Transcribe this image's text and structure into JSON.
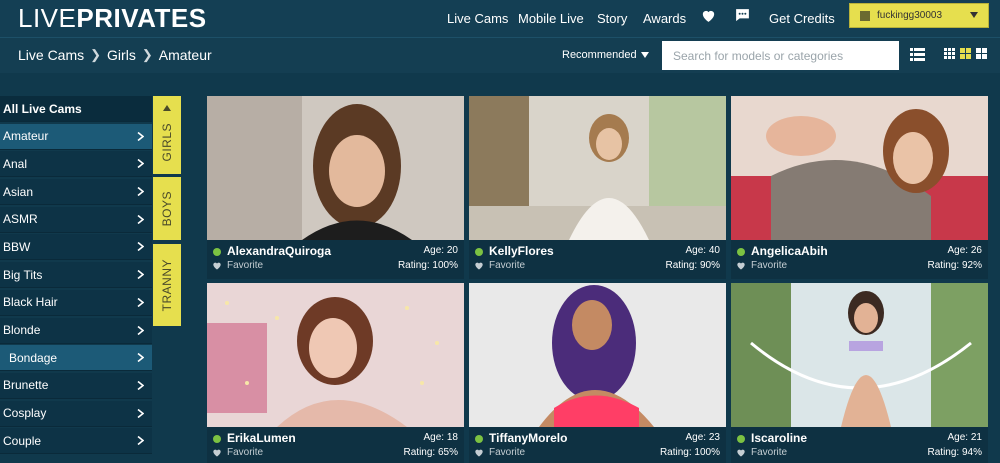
{
  "logo": {
    "part1": "LIVE",
    "part2": "PRIVATES"
  },
  "nav": {
    "live_cams": "Live Cams",
    "mobile_live": "Mobile Live",
    "story": "Story",
    "awards": "Awards",
    "get_credits": "Get Credits",
    "username": "fuckingg30003"
  },
  "breadcrumb": [
    "Live Cams",
    "Girls",
    "Amateur"
  ],
  "sort": {
    "label": "Recommended"
  },
  "search": {
    "placeholder": "Search for models or categories"
  },
  "sidebar": {
    "items": [
      {
        "label": "All Live Cams"
      },
      {
        "label": "Amateur"
      },
      {
        "label": "Anal"
      },
      {
        "label": "Asian"
      },
      {
        "label": "ASMR"
      },
      {
        "label": "BBW"
      },
      {
        "label": "Big Tits"
      },
      {
        "label": "Black Hair"
      },
      {
        "label": "Blonde"
      },
      {
        "label": "Bondage"
      },
      {
        "label": "Brunette"
      },
      {
        "label": "Cosplay"
      },
      {
        "label": "Couple"
      }
    ]
  },
  "tabs": {
    "girls": "GIRLS",
    "boys": "BOYS",
    "tranny": "TRANNY"
  },
  "models": [
    {
      "name": "AlexandraQuiroga",
      "age": "Age: 20",
      "favorite": "Favorite",
      "rating": "Rating: 100%"
    },
    {
      "name": "KellyFlores",
      "age": "Age: 40",
      "favorite": "Favorite",
      "rating": "Rating: 90%"
    },
    {
      "name": "AngelicaAbih",
      "age": "Age: 26",
      "favorite": "Favorite",
      "rating": "Rating: 92%"
    },
    {
      "name": "ErikaLumen",
      "age": "Age: 18",
      "favorite": "Favorite",
      "rating": "Rating: 65%"
    },
    {
      "name": "TiffanyMorelo",
      "age": "Age: 23",
      "favorite": "Favorite",
      "rating": "Rating: 100%"
    },
    {
      "name": "Iscaroline",
      "age": "Age: 21",
      "favorite": "Favorite",
      "rating": "Rating: 94%"
    }
  ],
  "colors": {
    "accent_yellow": "#e6df4e",
    "online_green": "#7cc242",
    "background": "#10394c",
    "sidebar_active": "#1c5a77"
  }
}
